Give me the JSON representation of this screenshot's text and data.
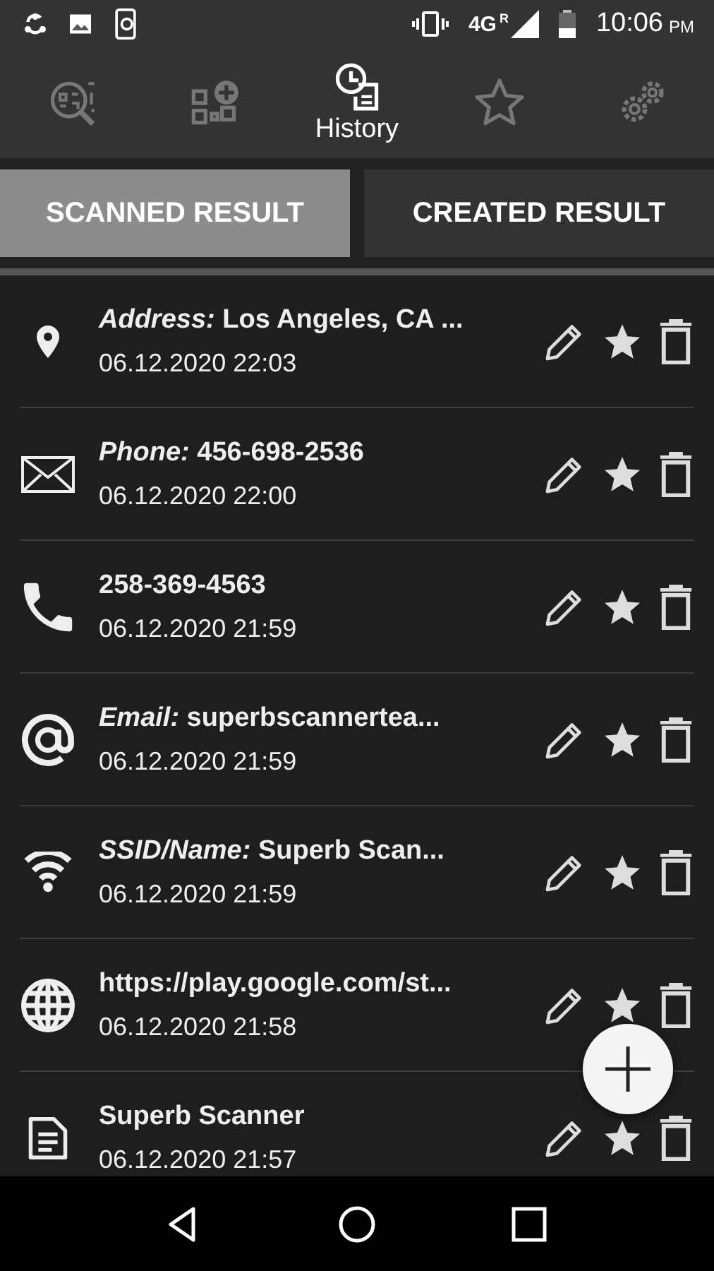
{
  "status_bar": {
    "network": "4G",
    "roaming": "R",
    "time": "10:06",
    "ampm": "PM"
  },
  "nav_tabs": [
    {
      "kind": "scan",
      "selected": false
    },
    {
      "kind": "create",
      "selected": false
    },
    {
      "kind": "history",
      "label": "History",
      "selected": true
    },
    {
      "kind": "favorites",
      "selected": false
    },
    {
      "kind": "settings",
      "selected": false
    }
  ],
  "result_tabs": [
    {
      "label": "SCANNED RESULT",
      "selected": true
    },
    {
      "label": "CREATED RESULT",
      "selected": false
    }
  ],
  "history": [
    {
      "kind": "location",
      "title": "*Address:* Los Angeles, CA ...",
      "date": "06.12.2020 22:03"
    },
    {
      "kind": "email",
      "title": "*Phone:* 456-698-2536",
      "date": "06.12.2020 22:00"
    },
    {
      "kind": "phone",
      "title": "258-369-4563",
      "date": "06.12.2020 21:59"
    },
    {
      "kind": "at",
      "title": "*Email:* superbscannertea...",
      "date": "06.12.2020 21:59"
    },
    {
      "kind": "wifi",
      "title": "*SSID/Name:* Superb Scan...",
      "date": "06.12.2020 21:59"
    },
    {
      "kind": "web",
      "title": "https://play.google.com/st...",
      "date": "06.12.2020 21:58"
    },
    {
      "kind": "text",
      "title": "Superb Scanner",
      "date": "06.12.2020 21:57"
    }
  ]
}
